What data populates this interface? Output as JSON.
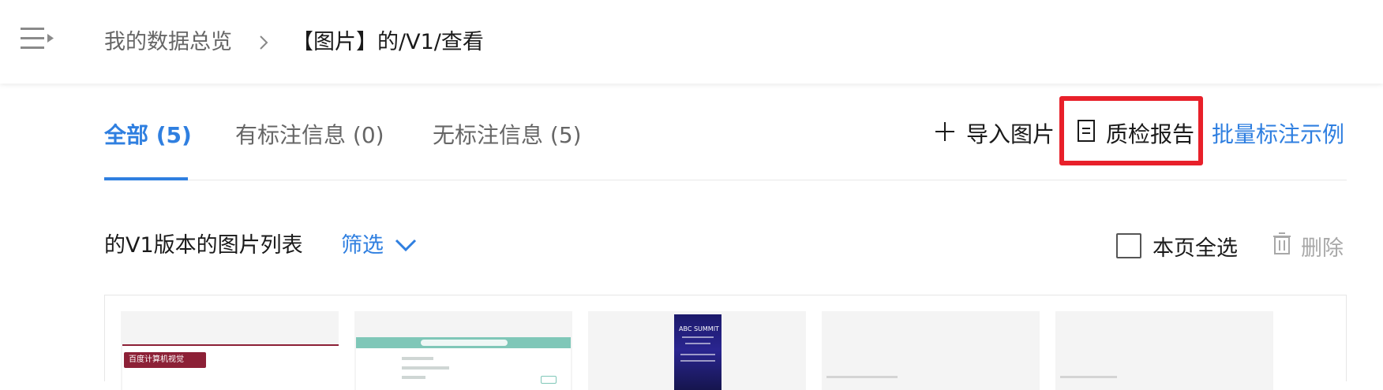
{
  "header": {
    "breadcrumb": {
      "root": "我的数据总览",
      "current": "【图片】的/V1/查看"
    }
  },
  "tabs": [
    {
      "label": "全部 (5)",
      "active": true
    },
    {
      "label": "有标注信息 (0)",
      "active": false
    },
    {
      "label": "无标注信息 (5)",
      "active": false
    }
  ],
  "actions": {
    "import_label": "导入图片",
    "report_label": "质检报告",
    "example_label": "批量标注示例"
  },
  "list": {
    "title": "的V1版本的图片列表",
    "filter_label": "筛选",
    "select_all_label": "本页全选",
    "select_all_checked": false,
    "delete_label": "删除"
  },
  "thumbnails": [
    {
      "caption": "百度计算机视觉"
    },
    {
      "caption": ""
    },
    {
      "caption": "ABC SUMMIT"
    },
    {
      "caption": ""
    },
    {
      "caption": ""
    }
  ],
  "colors": {
    "accent": "#2f7fe0",
    "highlight": "#e8202a",
    "text": "#1a1a1a",
    "muted": "#666666",
    "disabled": "#a8a8a8"
  },
  "icons": {
    "menu": "menu-collapse-icon",
    "breadcrumb_separator": "chevron-right-icon",
    "import": "plus-icon",
    "report": "document-icon",
    "filter": "chevron-down-icon",
    "delete": "trash-icon"
  }
}
